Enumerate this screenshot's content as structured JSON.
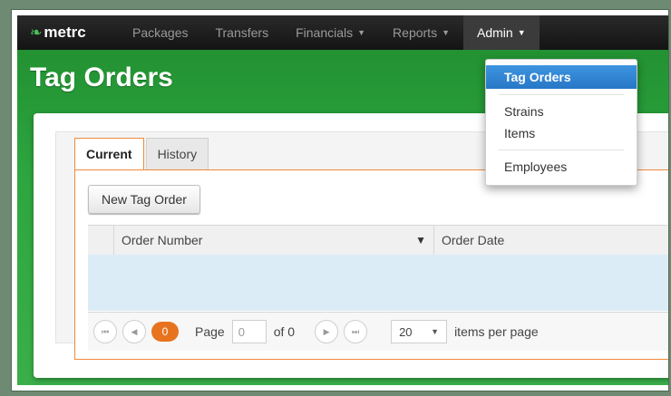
{
  "nav": {
    "brand": "metrc",
    "items": [
      {
        "label": "Packages",
        "caret": false
      },
      {
        "label": "Transfers",
        "caret": false
      },
      {
        "label": "Financials",
        "caret": true
      },
      {
        "label": "Reports",
        "caret": true
      },
      {
        "label": "Admin",
        "caret": true,
        "active": true
      }
    ]
  },
  "page": {
    "title": "Tag Orders"
  },
  "tabs": [
    "Current",
    "History"
  ],
  "toolbar": {
    "new_tag_order": "New Tag Order"
  },
  "grid": {
    "columns": [
      "Order Number",
      "Order Date"
    ]
  },
  "pager": {
    "current_page": "0",
    "page_label": "Page",
    "page_input": "0",
    "of_label": "of 0",
    "page_size": "20",
    "items_per_page": "items per page"
  },
  "admin_menu": {
    "items": [
      "Tag Orders",
      "Strains",
      "Items",
      "Employees"
    ]
  },
  "colors": {
    "accent_orange": "#e8731e",
    "highlight_blue": "#2f83d2",
    "header_green": "#2ea640"
  }
}
